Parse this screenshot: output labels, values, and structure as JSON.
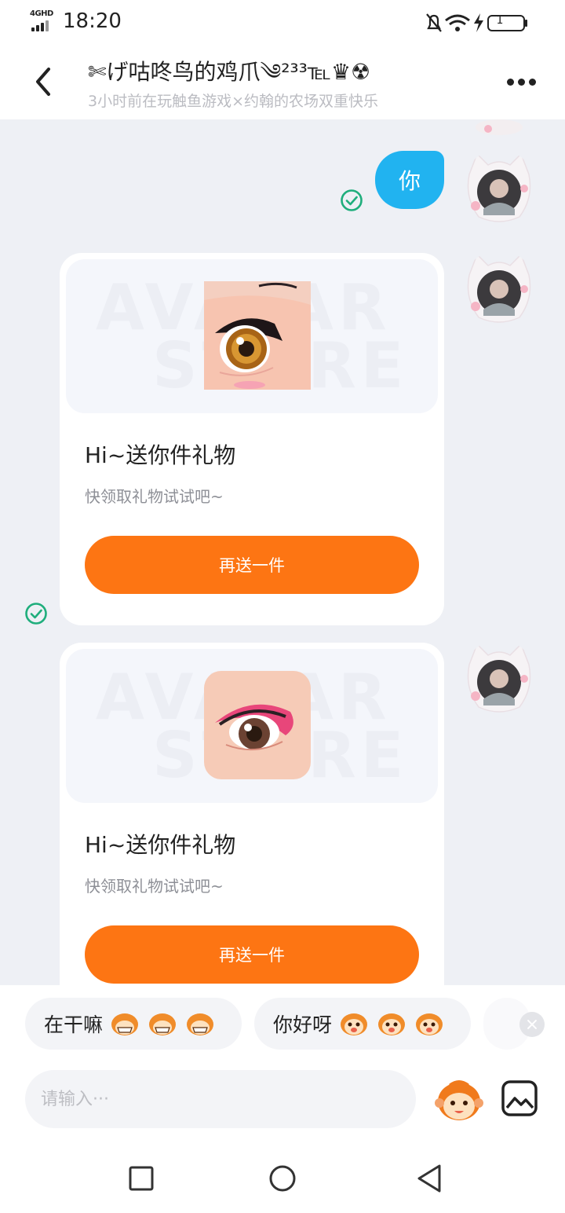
{
  "status_bar": {
    "network": "4GHD",
    "time": "18:20",
    "battery": "1"
  },
  "header": {
    "title": "✄げ咕咚鸟的鸡爪༄²³³℡♛☢",
    "subtitle": "3小时前在玩触鱼游戏×约翰的农场双重快乐"
  },
  "chat": {
    "my_message": "你",
    "gift_cards": [
      {
        "title": "Hi~送你件礼物",
        "desc": "快领取礼物试试吧~",
        "button": "再送一件",
        "watermark_1": "AVATAR",
        "watermark_2": "STORE"
      },
      {
        "title": "Hi~送你件礼物",
        "desc": "快领取礼物试试吧~",
        "button": "再送一件",
        "watermark_1": "AVATAR",
        "watermark_2": "STORE"
      }
    ]
  },
  "quick_replies": [
    {
      "text": "在干嘛",
      "emoji_icon": "monkey-grin-icon"
    },
    {
      "text": "你好呀",
      "emoji_icon": "monkey-face-icon"
    }
  ],
  "input": {
    "placeholder": "请输入···"
  },
  "colors": {
    "accent_orange": "#fd7513",
    "bubble_blue": "#21b3f0",
    "check_green": "#1fae7c",
    "background": "#eef0f5"
  },
  "icons": {
    "back": "chevron-left-icon",
    "more": "more-dots-icon",
    "sent": "check-circle-icon",
    "emoji": "monkey-sticker-icon",
    "image": "image-icon",
    "nav": [
      "square-icon",
      "circle-icon",
      "triangle-back-icon"
    ]
  }
}
